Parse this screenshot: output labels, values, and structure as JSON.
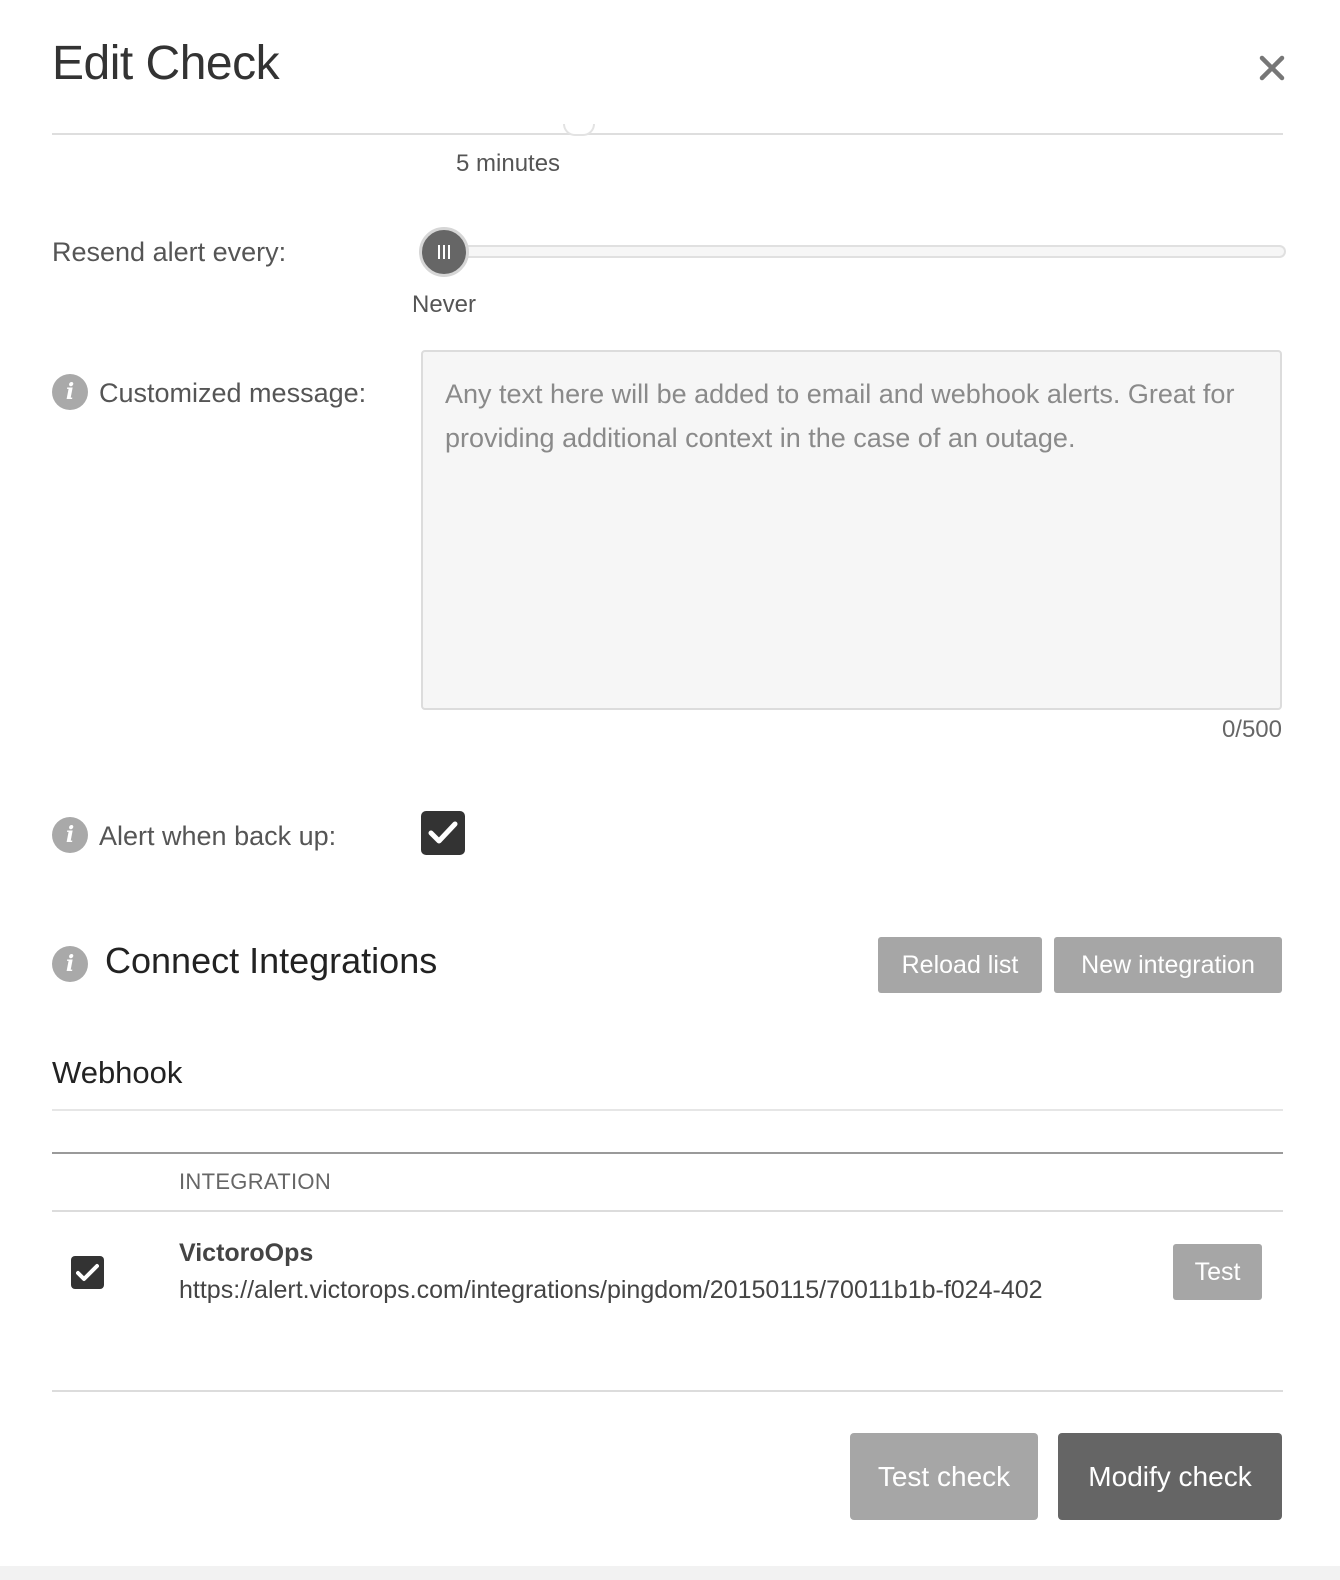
{
  "modal": {
    "title": "Edit Check"
  },
  "notify_after": {
    "value_label": "5 minutes"
  },
  "resend": {
    "label": "Resend alert every:",
    "value_label": "Never"
  },
  "custom_message": {
    "label": "Customized message:",
    "placeholder": "Any text here will be added to email and webhook alerts. Great for providing additional context in the case of an outage.",
    "value": "",
    "char_count": "0/500"
  },
  "alert_back_up": {
    "label": "Alert when back up:",
    "checked": true
  },
  "integrations": {
    "title": "Connect Integrations",
    "reload_label": "Reload list",
    "new_label": "New integration",
    "group_title": "Webhook",
    "column_header": "INTEGRATION",
    "rows": [
      {
        "checked": true,
        "name": "VictoroOps",
        "url": "https://alert.victorops.com/integrations/pingdom/20150115/70011b1b-f024-402",
        "test_label": "Test"
      }
    ]
  },
  "footer": {
    "test_check_label": "Test check",
    "modify_check_label": "Modify check"
  },
  "colors": {
    "primary_button": "#656565",
    "secondary_button": "#a6a6a6",
    "checkbox": "#333333",
    "info_icon": "#a9a9a9"
  },
  "icons": {
    "close": "close-icon",
    "info": "info-icon",
    "check": "checkmark-icon",
    "slider_grip": "grip-icon"
  }
}
